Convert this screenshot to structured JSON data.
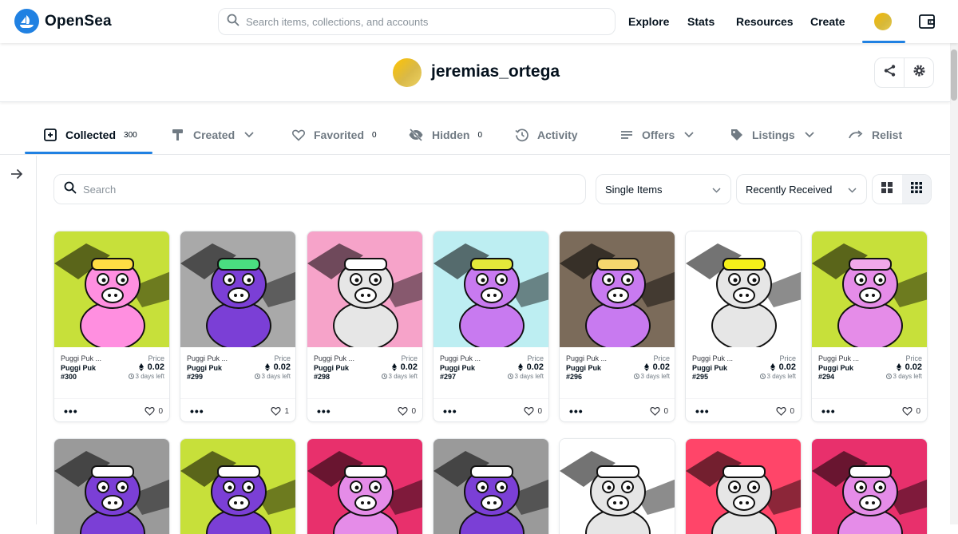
{
  "nav": {
    "brand": "OpenSea",
    "search_placeholder": "Search items, collections, and accounts",
    "links": [
      "Explore",
      "Stats",
      "Resources",
      "Create"
    ]
  },
  "profile": {
    "username": "jeremias_ortega"
  },
  "tabs": [
    {
      "label": "Collected",
      "count": "300",
      "icon": "collected-icon",
      "active": true
    },
    {
      "label": "Created",
      "count": "",
      "icon": "created-icon",
      "dropdown": true
    },
    {
      "label": "Favorited",
      "count": "0",
      "icon": "heart-icon"
    },
    {
      "label": "Hidden",
      "count": "0",
      "icon": "hidden-icon"
    },
    {
      "label": "Activity",
      "count": "",
      "icon": "activity-icon"
    },
    {
      "label": "Offers",
      "count": "",
      "icon": "offers-icon",
      "dropdown": true
    },
    {
      "label": "Listings",
      "count": "",
      "icon": "tag-icon",
      "dropdown": true
    },
    {
      "label": "Relist",
      "count": "",
      "icon": "relist-icon"
    }
  ],
  "filters": {
    "search_placeholder": "Search",
    "item_type": "Single Items",
    "sort": "Recently Received"
  },
  "colors": {
    "accent": "#2081e2"
  },
  "cards": [
    {
      "collection": "Puggi Puk ...",
      "name": "Puggi Puk",
      "number": "#300",
      "price_label": "Price",
      "price": "0.02",
      "time_left": "3 days left",
      "likes": "0",
      "bg": "#c7e03a",
      "body": "#ff8fe0",
      "accent": "#ffdd44"
    },
    {
      "collection": "Puggi Puk ...",
      "name": "Puggi Puk",
      "number": "#299",
      "price_label": "Price",
      "price": "0.02",
      "time_left": "3 days left",
      "likes": "1",
      "bg": "#a9a9a9",
      "body": "#7b3fd6",
      "accent": "#4ade80"
    },
    {
      "collection": "Puggi Puk ...",
      "name": "Puggi Puk",
      "number": "#298",
      "price_label": "Price",
      "price": "0.02",
      "time_left": "3 days left",
      "likes": "0",
      "bg": "#f6a3c9",
      "body": "#e6e6e6",
      "accent": "#ffffff"
    },
    {
      "collection": "Puggi Puk ...",
      "name": "Puggi Puk",
      "number": "#297",
      "price_label": "Price",
      "price": "0.02",
      "time_left": "3 days left",
      "likes": "0",
      "bg": "#bdeef2",
      "body": "#c87af0",
      "accent": "#e3e83a"
    },
    {
      "collection": "Puggi Puk ...",
      "name": "Puggi Puk",
      "number": "#296",
      "price_label": "Price",
      "price": "0.02",
      "time_left": "3 days left",
      "likes": "0",
      "bg": "#7b6b5a",
      "body": "#c87af0",
      "accent": "#f5d76e"
    },
    {
      "collection": "Puggi Puk ...",
      "name": "Puggi Puk",
      "number": "#295",
      "price_label": "Price",
      "price": "0.02",
      "time_left": "3 days left",
      "likes": "0",
      "bg": "#ffffff",
      "body": "#e6e6e6",
      "accent": "#f5ef1a"
    },
    {
      "collection": "Puggi Puk ...",
      "name": "Puggi Puk",
      "number": "#294",
      "price_label": "Price",
      "price": "0.02",
      "time_left": "3 days left",
      "likes": "0",
      "bg": "#c7e03a",
      "body": "#e58ce8",
      "accent": "#f0a8ea"
    }
  ],
  "cards_row2": [
    {
      "bg": "#9a9a9a",
      "body": "#7b3fd6"
    },
    {
      "bg": "#c7e03a",
      "body": "#7b3fd6"
    },
    {
      "bg": "#e8306c",
      "body": "#e58ce8"
    },
    {
      "bg": "#9a9a9a",
      "body": "#7b3fd6"
    },
    {
      "bg": "#ffffff",
      "body": "#e6e6e6"
    },
    {
      "bg": "#ff4569",
      "body": "#e6e6e6"
    },
    {
      "bg": "#e8306c",
      "body": "#e58ce8"
    }
  ]
}
